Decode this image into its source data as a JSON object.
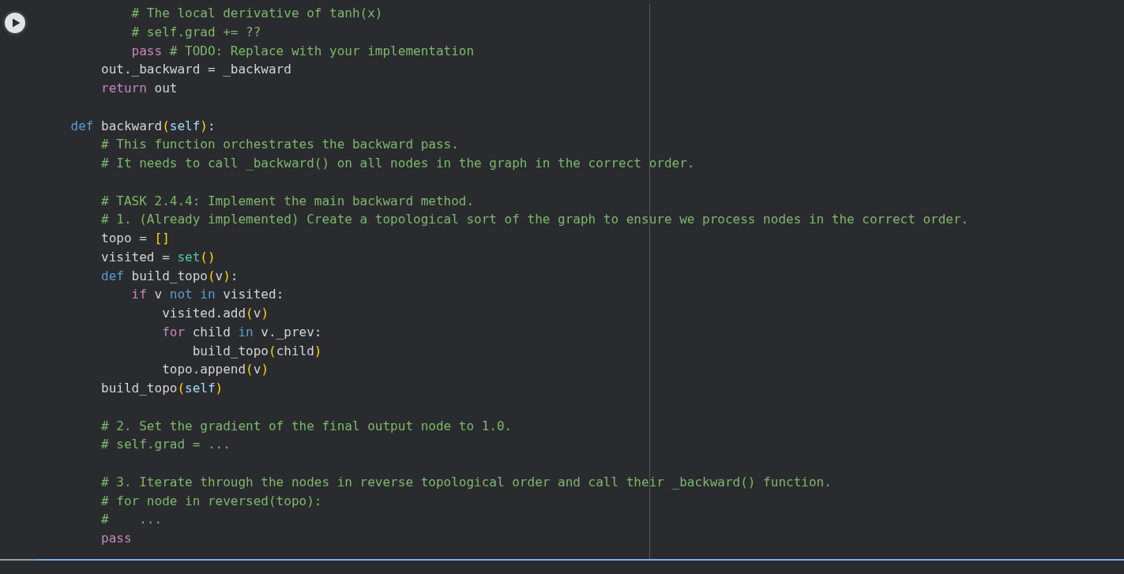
{
  "cell": {
    "lines": [
      {
        "kind": "code",
        "tokens": [
          {
            "text": "            # The local derivative of tanh(x)",
            "kind": "comment"
          }
        ]
      },
      {
        "kind": "code",
        "tokens": [
          {
            "text": "            # self.grad += ??",
            "kind": "comment"
          }
        ]
      },
      {
        "kind": "code",
        "tokens": [
          {
            "text": "            pass",
            "kind": "control"
          },
          {
            "text": " # TODO: Replace with your implementation",
            "kind": "comment"
          }
        ]
      },
      {
        "kind": "code",
        "tokens": [
          {
            "text": "        out._backward = _backward",
            "kind": "plain"
          }
        ]
      },
      {
        "kind": "code",
        "tokens": [
          {
            "text": "        return",
            "kind": "control"
          },
          {
            "text": " out",
            "kind": "plain"
          }
        ]
      },
      {
        "kind": "blank"
      },
      {
        "kind": "code",
        "tokens": [
          {
            "text": "    def",
            "kind": "keyword"
          },
          {
            "text": " backward",
            "kind": "plain"
          },
          {
            "text": "(",
            "kind": "bracket"
          },
          {
            "text": "self",
            "kind": "self"
          },
          {
            "text": ")",
            "kind": "bracket"
          },
          {
            "text": ":",
            "kind": "plain"
          }
        ]
      },
      {
        "kind": "code",
        "tokens": [
          {
            "text": "        # This function orchestrates the backward pass.",
            "kind": "comment"
          }
        ]
      },
      {
        "kind": "code",
        "tokens": [
          {
            "text": "        # It needs to call _backward() on all nodes in the graph in the correct order.",
            "kind": "comment"
          }
        ]
      },
      {
        "kind": "blank"
      },
      {
        "kind": "code",
        "tokens": [
          {
            "text": "        # TASK 2.4.4: Implement the main backward method.",
            "kind": "comment"
          }
        ]
      },
      {
        "kind": "code",
        "tokens": [
          {
            "text": "        # 1. (Already implemented) Create a topological sort of the graph to ensure we process nodes in the correct order.",
            "kind": "comment"
          }
        ]
      },
      {
        "kind": "code",
        "tokens": [
          {
            "text": "        topo = ",
            "kind": "plain"
          },
          {
            "text": "[]",
            "kind": "bracket"
          }
        ]
      },
      {
        "kind": "code",
        "tokens": [
          {
            "text": "        visited = ",
            "kind": "plain"
          },
          {
            "text": "set",
            "kind": "builtin"
          },
          {
            "text": "()",
            "kind": "bracket"
          }
        ]
      },
      {
        "kind": "code",
        "tokens": [
          {
            "text": "        def",
            "kind": "keyword"
          },
          {
            "text": " build_topo",
            "kind": "plain"
          },
          {
            "text": "(",
            "kind": "bracket"
          },
          {
            "text": "v",
            "kind": "plain"
          },
          {
            "text": ")",
            "kind": "bracket"
          },
          {
            "text": ":",
            "kind": "plain"
          }
        ]
      },
      {
        "kind": "code",
        "tokens": [
          {
            "text": "            if",
            "kind": "control"
          },
          {
            "text": " v ",
            "kind": "plain"
          },
          {
            "text": "not in",
            "kind": "keyword"
          },
          {
            "text": " visited:",
            "kind": "plain"
          }
        ]
      },
      {
        "kind": "code",
        "tokens": [
          {
            "text": "                visited.add",
            "kind": "plain"
          },
          {
            "text": "(",
            "kind": "bracket"
          },
          {
            "text": "v",
            "kind": "plain"
          },
          {
            "text": ")",
            "kind": "bracket"
          }
        ]
      },
      {
        "kind": "code",
        "tokens": [
          {
            "text": "                for",
            "kind": "control"
          },
          {
            "text": " child ",
            "kind": "plain"
          },
          {
            "text": "in",
            "kind": "keyword"
          },
          {
            "text": " v._prev:",
            "kind": "plain"
          }
        ]
      },
      {
        "kind": "code",
        "tokens": [
          {
            "text": "                    build_topo",
            "kind": "plain"
          },
          {
            "text": "(",
            "kind": "bracket"
          },
          {
            "text": "child",
            "kind": "plain"
          },
          {
            "text": ")",
            "kind": "bracket"
          }
        ]
      },
      {
        "kind": "code",
        "tokens": [
          {
            "text": "                topo.append",
            "kind": "plain"
          },
          {
            "text": "(",
            "kind": "bracket"
          },
          {
            "text": "v",
            "kind": "plain"
          },
          {
            "text": ")",
            "kind": "bracket"
          }
        ]
      },
      {
        "kind": "code",
        "tokens": [
          {
            "text": "        build_topo",
            "kind": "plain"
          },
          {
            "text": "(",
            "kind": "bracket"
          },
          {
            "text": "self",
            "kind": "self"
          },
          {
            "text": ")",
            "kind": "bracket"
          }
        ]
      },
      {
        "kind": "blank"
      },
      {
        "kind": "code",
        "tokens": [
          {
            "text": "        # 2. Set the gradient of the final output node to 1.0.",
            "kind": "comment"
          }
        ]
      },
      {
        "kind": "code",
        "tokens": [
          {
            "text": "        # self.grad = ...",
            "kind": "comment"
          }
        ]
      },
      {
        "kind": "blank"
      },
      {
        "kind": "code",
        "tokens": [
          {
            "text": "        # 3. Iterate through the nodes in reverse topological order and call their _backward() function.",
            "kind": "comment"
          }
        ]
      },
      {
        "kind": "code",
        "tokens": [
          {
            "text": "        # for node in reversed(topo):",
            "kind": "comment"
          }
        ]
      },
      {
        "kind": "code",
        "tokens": [
          {
            "text": "        #    ...",
            "kind": "comment"
          }
        ]
      },
      {
        "kind": "code",
        "tokens": [
          {
            "text": "        pass",
            "kind": "control"
          }
        ]
      }
    ]
  }
}
